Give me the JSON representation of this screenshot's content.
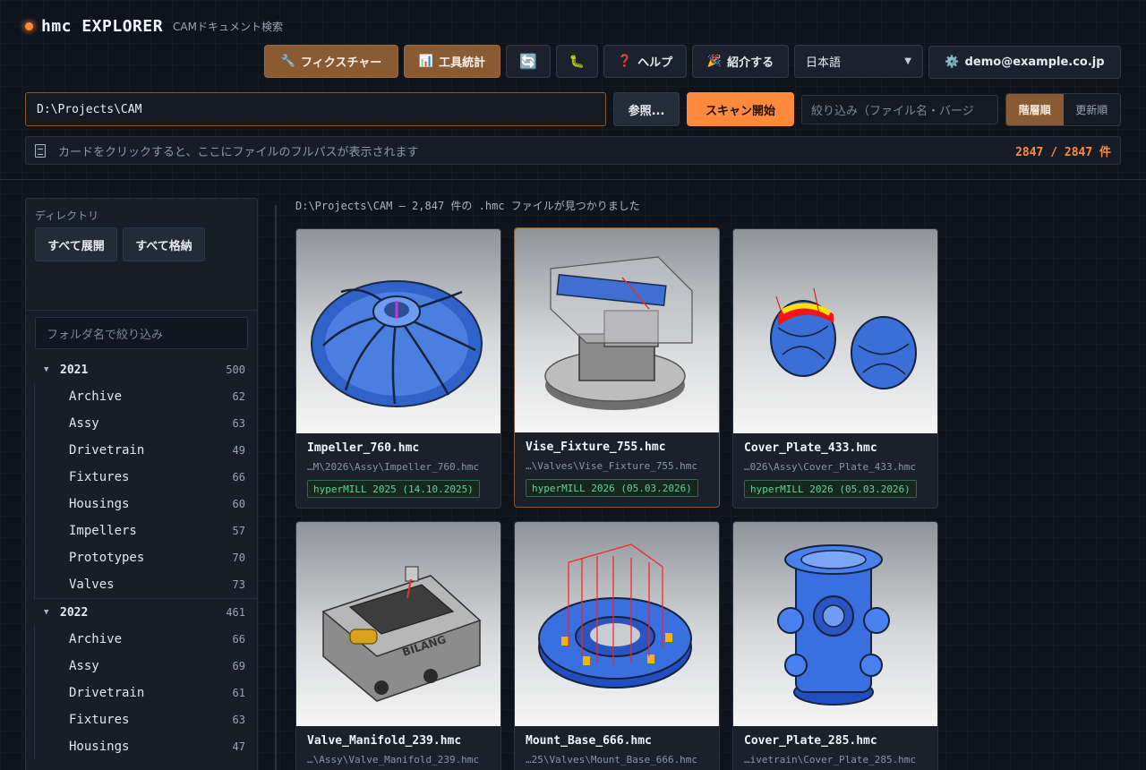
{
  "app": {
    "title": "hmc EXPLORER",
    "subtitle": "CAMドキュメント検索"
  },
  "toolbar": {
    "fixture_label": "フィクスチャー",
    "stats_label": "工具統計",
    "refresh_icon": "refresh-icon",
    "bug_icon": "bug-icon",
    "help_label": "ヘルプ",
    "invite_label": "紹介する",
    "language": "日本語",
    "user": "demo@example.co.jp"
  },
  "scan": {
    "path_value": "D:\\Projects\\CAM",
    "browse_label": "参照...",
    "scan_label": "スキャン開始",
    "filter_placeholder": "絞り込み（ファイル名・バージ",
    "sort_tree": "階層順",
    "sort_updated": "更新順"
  },
  "pathbar": {
    "hint": "カードをクリックすると、ここにファイルのフルパスが表示されます",
    "count": "2847 / 2847 件"
  },
  "sidebar": {
    "title": "ディレクトリ",
    "expand_all": "すべて展開",
    "collapse_all": "すべて格納",
    "folder_filter_placeholder": "フォルダ名で絞り込み",
    "years": [
      {
        "year": "2021",
        "count": "500",
        "folders": [
          {
            "name": "Archive",
            "count": "62"
          },
          {
            "name": "Assy",
            "count": "63"
          },
          {
            "name": "Drivetrain",
            "count": "49"
          },
          {
            "name": "Fixtures",
            "count": "66"
          },
          {
            "name": "Housings",
            "count": "60"
          },
          {
            "name": "Impellers",
            "count": "57"
          },
          {
            "name": "Prototypes",
            "count": "70"
          },
          {
            "name": "Valves",
            "count": "73"
          }
        ]
      },
      {
        "year": "2022",
        "count": "461",
        "folders": [
          {
            "name": "Archive",
            "count": "66"
          },
          {
            "name": "Assy",
            "count": "69"
          },
          {
            "name": "Drivetrain",
            "count": "61"
          },
          {
            "name": "Fixtures",
            "count": "63"
          },
          {
            "name": "Housings",
            "count": "47"
          }
        ]
      }
    ]
  },
  "results": {
    "summary": "D:\\Projects\\CAM — 2,847 件の .hmc ファイルが見つかりました",
    "cards": [
      {
        "name": "Impeller_760.hmc",
        "path": "…M\\2026\\Assy\\Impeller_760.hmc",
        "tag": "hyperMILL 2025 (14.10.2025)"
      },
      {
        "name": "Vise_Fixture_755.hmc",
        "path": "…\\Valves\\Vise_Fixture_755.hmc",
        "tag": "hyperMILL 2026 (05.03.2026)"
      },
      {
        "name": "Cover_Plate_433.hmc",
        "path": "…026\\Assy\\Cover_Plate_433.hmc",
        "tag": "hyperMILL 2026 (05.03.2026)"
      },
      {
        "name": "Valve_Manifold_239.hmc",
        "path": "…\\Assy\\Valve_Manifold_239.hmc",
        "tag": ""
      },
      {
        "name": "Mount_Base_666.hmc",
        "path": "…25\\Valves\\Mount_Base_666.hmc",
        "tag": ""
      },
      {
        "name": "Cover_Plate_285.hmc",
        "path": "…ivetrain\\Cover_Plate_285.hmc",
        "tag": ""
      }
    ],
    "thumb_text": "BILANG"
  },
  "colors": {
    "accent": "#ff8a3d",
    "brown": "#8a5a33",
    "tag_green": "#5fd49a",
    "background": "#0f141c"
  }
}
